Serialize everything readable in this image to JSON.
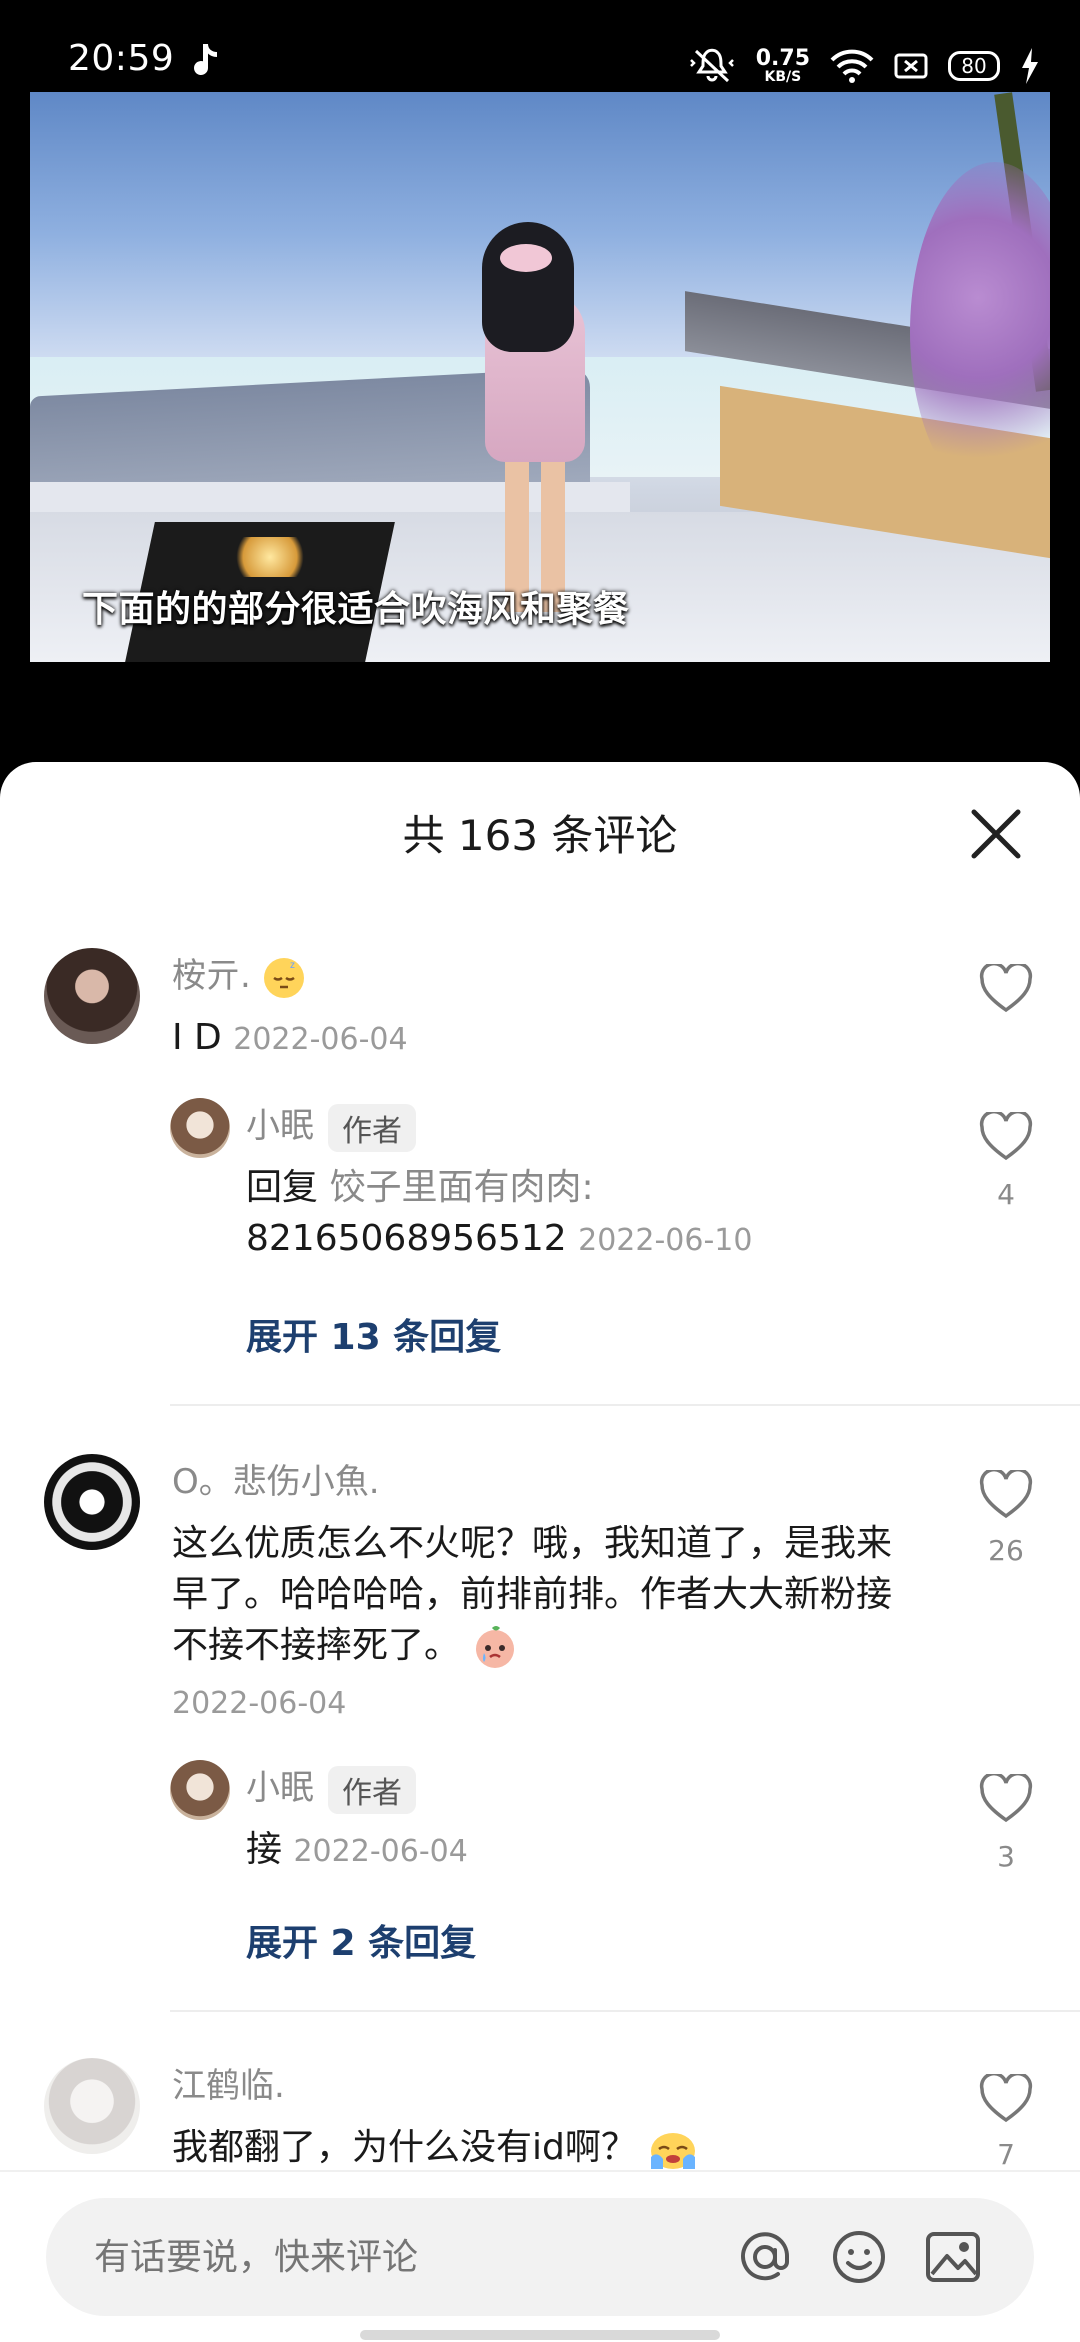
{
  "status": {
    "time": "20:59",
    "net_speed": "0.75",
    "net_unit": "KB/S",
    "battery": "80"
  },
  "video": {
    "subtitle": "下面的的部分很适合吹海风和聚餐"
  },
  "sheet": {
    "title": "共 163 条评论"
  },
  "comments": [
    {
      "name": "桉亓.",
      "text": "I D",
      "date": "2022-06-04",
      "likes": "",
      "reply": {
        "name": "小眠",
        "tag": "作者",
        "prefix": "回复",
        "target": "饺子里面有肉肉:",
        "text": "82165068956512",
        "date": "2022-06-10",
        "likes": "4"
      },
      "expand": "展开 13 条回复"
    },
    {
      "name": "O。悲伤小魚.",
      "text": "这么优质怎么不火呢？哦，我知道了，是我来早了。哈哈哈哈，前排前排。作者大大新粉接不接不接摔死了。",
      "date": "2022-06-04",
      "likes": "26",
      "reply": {
        "name": "小眠",
        "tag": "作者",
        "text": "接",
        "date": "2022-06-04",
        "likes": "3"
      },
      "expand": "展开 2 条回复"
    },
    {
      "name": "江鹤临.",
      "text": "我都翻了，为什么没有id啊？",
      "likes": "7"
    }
  ],
  "input": {
    "placeholder": "有话要说，快来评论"
  },
  "icons": [
    "music-note-icon",
    "mute-icon",
    "wifi-icon",
    "sim-icon",
    "battery-icon",
    "charging-icon",
    "close-icon",
    "heart-icon",
    "at-icon",
    "emoji-icon",
    "image-icon"
  ]
}
